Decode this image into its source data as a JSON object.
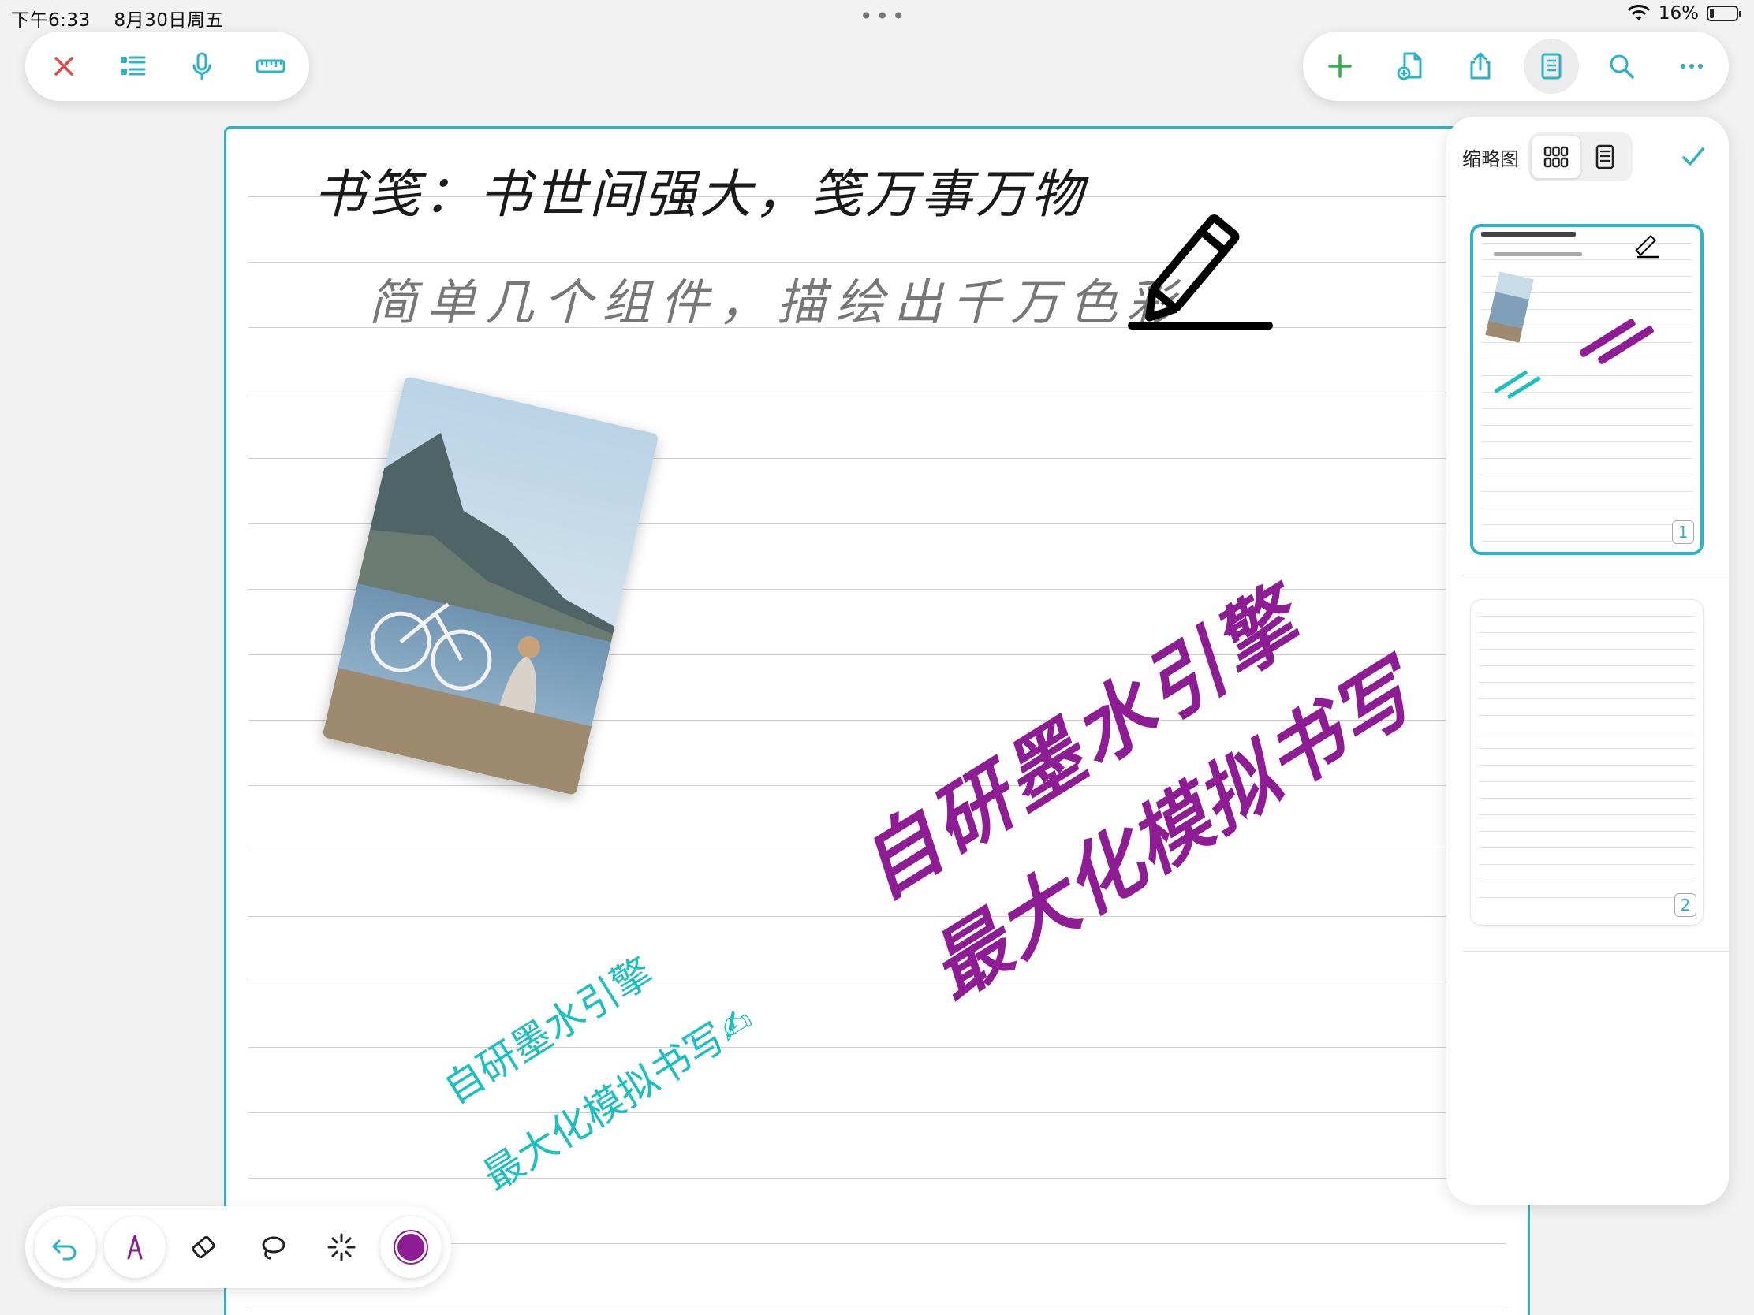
{
  "status_bar": {
    "time": "下午6:33",
    "date": "8月30日周五",
    "dots": "•••",
    "battery": "16%"
  },
  "top_left_toolbar": {
    "items": [
      "close-icon",
      "list-icon",
      "microphone-icon",
      "ruler-icon"
    ]
  },
  "top_right_toolbar": {
    "items": [
      "plus-icon",
      "new-page-icon",
      "share-icon",
      "pages-panel-icon",
      "search-icon",
      "more-icon"
    ]
  },
  "page": {
    "title_handwriting": "书笺：书世间强大，笺万事万物",
    "subtitle_handwriting": "简单几个组件，描绘出千万色彩",
    "purple_line1": "自研墨水引擎",
    "purple_line2": "最大化模拟书写",
    "teal_line1": "自研墨水引擎",
    "teal_line2": "最大化模拟书写✍"
  },
  "thumbnail_panel": {
    "title": "缩略图",
    "thumbnails": [
      {
        "page": "1",
        "selected": true
      },
      {
        "page": "2",
        "selected": false
      }
    ]
  },
  "bottom_toolbar": {
    "items": [
      "undo-icon",
      "pen-icon",
      "eraser-icon",
      "lasso-icon",
      "magic-icon",
      "color-swatch"
    ],
    "color": "#8e1d95"
  },
  "colors": {
    "accent_teal": "#2bb3c7",
    "ink_purple": "#8e1d95",
    "ink_teal": "#1cc0c0",
    "add_green": "#2ab54a",
    "close_red": "#e84545"
  }
}
